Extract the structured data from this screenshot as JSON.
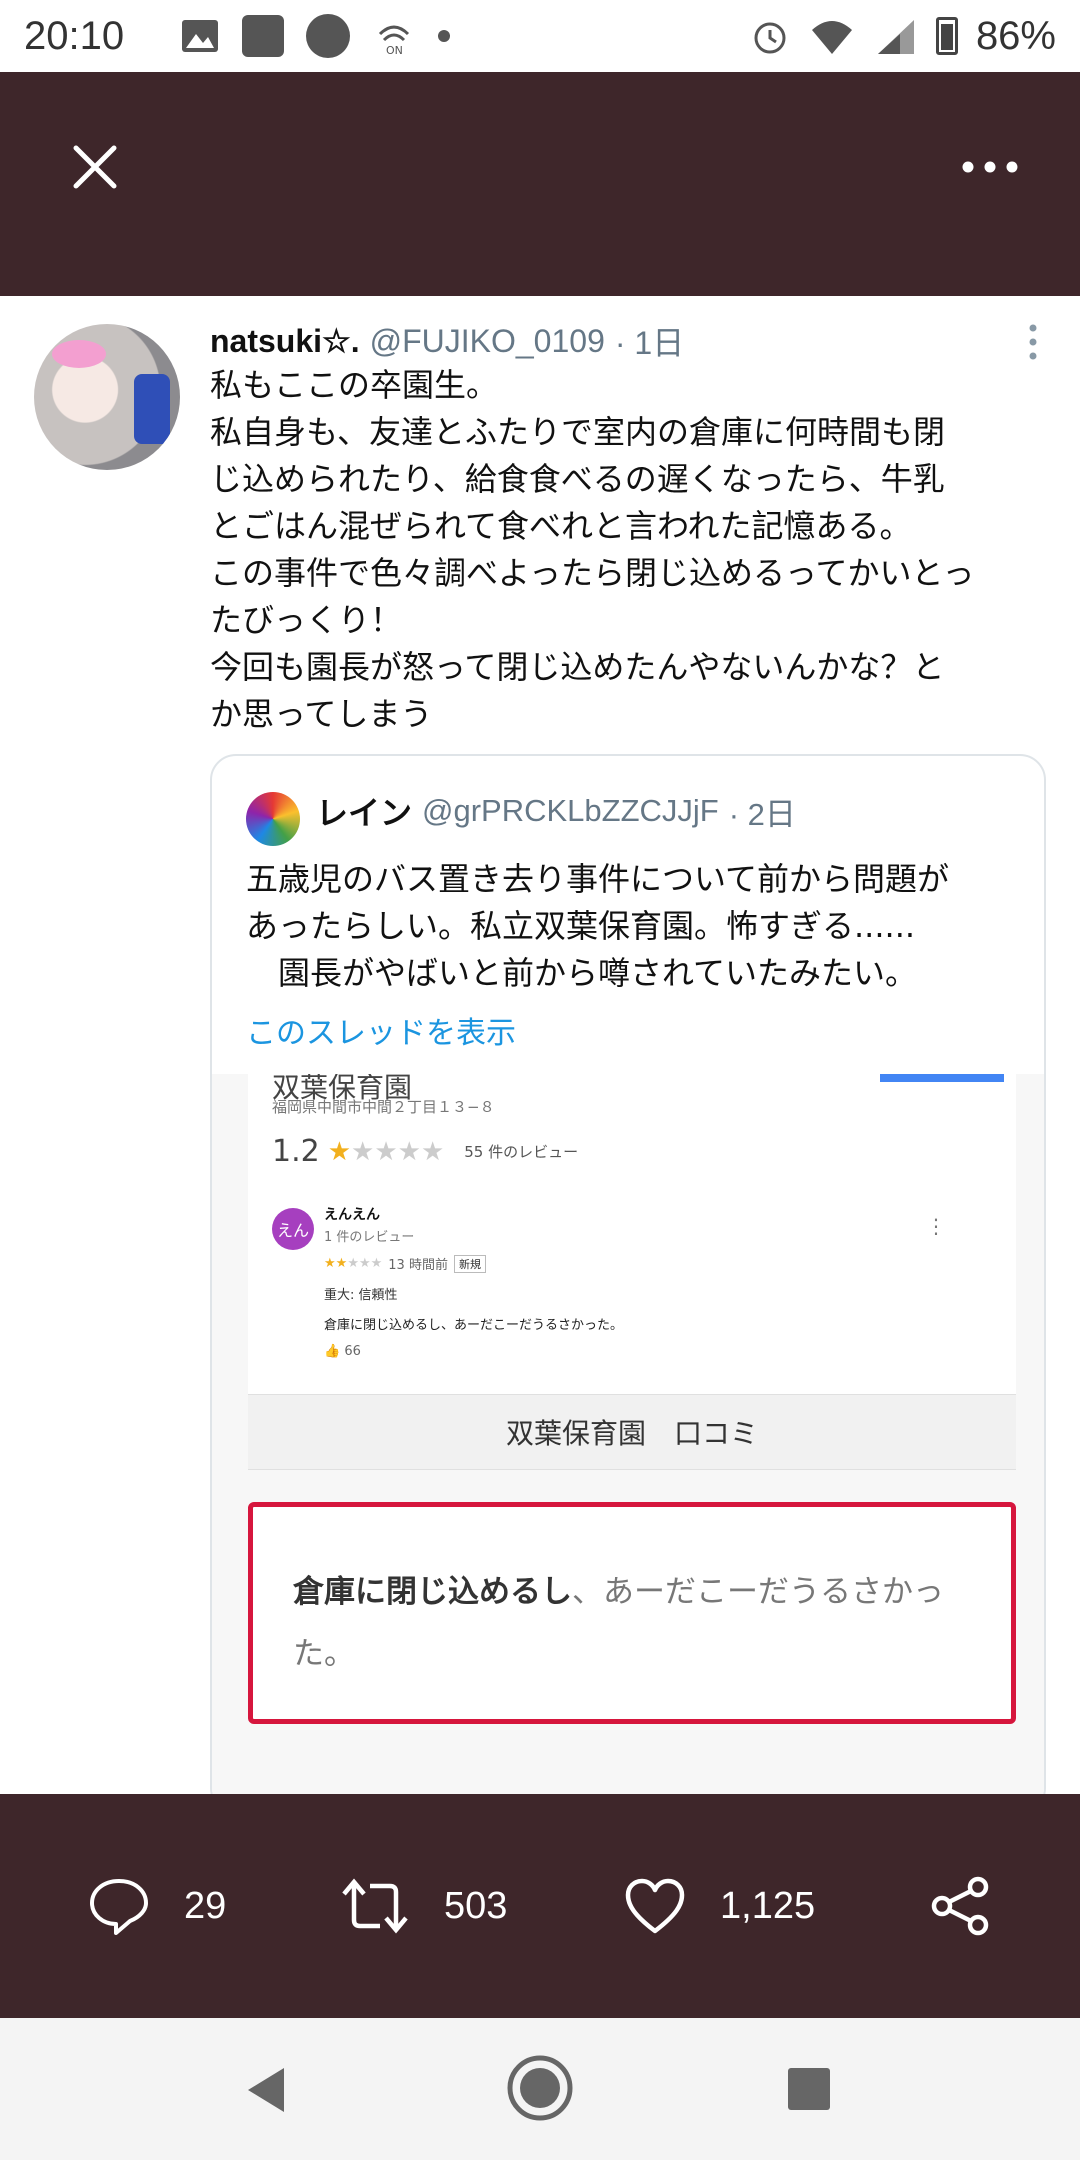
{
  "status_bar": {
    "time": "20:10",
    "battery": "86%",
    "nfc_label": "ON"
  },
  "tweet": {
    "name": "natsuki☆.",
    "handle": "@FUJIKO_0109",
    "time": "· 1日",
    "text": "私もここの卒園生。\n私自身も、友達とふたりで室内の倉庫に何時間も閉\nじ込められたり、給食食べるの遅くなったら、牛乳\nとごはん混ぜられて食べれと言われた記憶ある。\nこの事件で色々調べよったら閉じ込めるってかいとっ\nたびっくり！\n今回も園長が怒って閉じ込めたんやないんかな？と\nか思ってしまう"
  },
  "quote": {
    "name": "レイン",
    "handle": "@grPRCKLbZZCJJjF",
    "time": "· 2日",
    "text": "五歳児のバス置き去り事件について前から問題が\nあったらしい。私立双葉保育園。怖すぎる......\n　園長がやばいと前から噂されていたみたい。",
    "thread_link": "このスレッドを表示",
    "image": {
      "title": "双葉保育園",
      "address": "福岡県中間市中間２丁目１３−８",
      "rating": "1.2",
      "review_count": "55 件のレビュー",
      "reviewer_initial": "えん",
      "reviewer": "えんえん",
      "reviewer_sub": "1 件のレビュー",
      "review_time": "13 時間前",
      "badge": "新規",
      "severity": "重大: 信頼性",
      "review_text": "倉庫に閉じ込めるし、あーだこーだうるさかった。",
      "likes": "66",
      "caption": "双葉保育園　口コミ",
      "highlight_bold": "倉庫に閉じ込めるし",
      "highlight_rest": "、あーだこーだうるさかった。"
    }
  },
  "actions": {
    "replies": "29",
    "retweets": "503",
    "likes": "1,125"
  }
}
